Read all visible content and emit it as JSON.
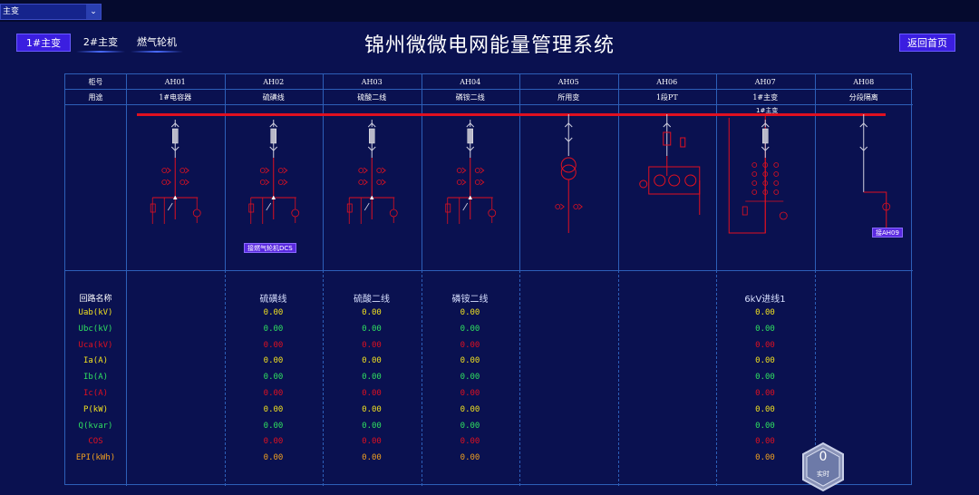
{
  "topbar": {
    "selector_value": "主变"
  },
  "nav": {
    "btn1": "1#主变",
    "btn2": "2#主变",
    "btn3": "燃气轮机"
  },
  "title": "锦州微微电网能量管理系统",
  "back_button": "返回首页",
  "header": {
    "row1_label": "柜号",
    "row2_label": "用途",
    "cabinets": [
      "AH01",
      "AH02",
      "AH03",
      "AH04",
      "AH05",
      "AH06",
      "AH07",
      "AH08"
    ],
    "purposes": [
      "1#电容器",
      "硫磺线",
      "硫酸二线",
      "磷铵二线",
      "所用变",
      "1段PT",
      "1#主变",
      "分段隔离"
    ]
  },
  "diagram": {
    "bus_name": "1#主变",
    "gas_turbine_label": "接燃气轮机DCS",
    "ah09_label": "接AH09"
  },
  "params": {
    "title": "回路名称",
    "rows": [
      {
        "name": "Uab(kV)",
        "color": "#f0e020"
      },
      {
        "name": "Ubc(kV)",
        "color": "#30e060"
      },
      {
        "name": "Uca(kV)",
        "color": "#e01020"
      },
      {
        "name": "Ia(A)",
        "color": "#f0e020"
      },
      {
        "name": "Ib(A)",
        "color": "#30e060"
      },
      {
        "name": "Ic(A)",
        "color": "#e01020"
      },
      {
        "name": "P(kW)",
        "color": "#f0e020"
      },
      {
        "name": "Q(kvar)",
        "color": "#30e060"
      },
      {
        "name": "COS",
        "color": "#e01020"
      },
      {
        "name": "EPI(kWh)",
        "color": "#f0a020"
      }
    ]
  },
  "circuits": [
    {
      "name": "硫磺线",
      "values": [
        "0.00",
        "0.00",
        "0.00",
        "0.00",
        "0.00",
        "0.00",
        "0.00",
        "0.00",
        "0.00",
        "0.00"
      ]
    },
    {
      "name": "硫酸二线",
      "values": [
        "0.00",
        "0.00",
        "0.00",
        "0.00",
        "0.00",
        "0.00",
        "0.00",
        "0.00",
        "0.00",
        "0.00"
      ]
    },
    {
      "name": "磷铵二线",
      "values": [
        "0.00",
        "0.00",
        "0.00",
        "0.00",
        "0.00",
        "0.00",
        "0.00",
        "0.00",
        "0.00",
        "0.00"
      ]
    },
    {
      "name": "6kV进线1",
      "values": [
        "0.00",
        "0.00",
        "0.00",
        "0.00",
        "0.00",
        "0.00",
        "0.00",
        "0.00",
        "0.00",
        "0.00"
      ]
    }
  ],
  "realtime": {
    "count": "0",
    "label": "实时"
  }
}
